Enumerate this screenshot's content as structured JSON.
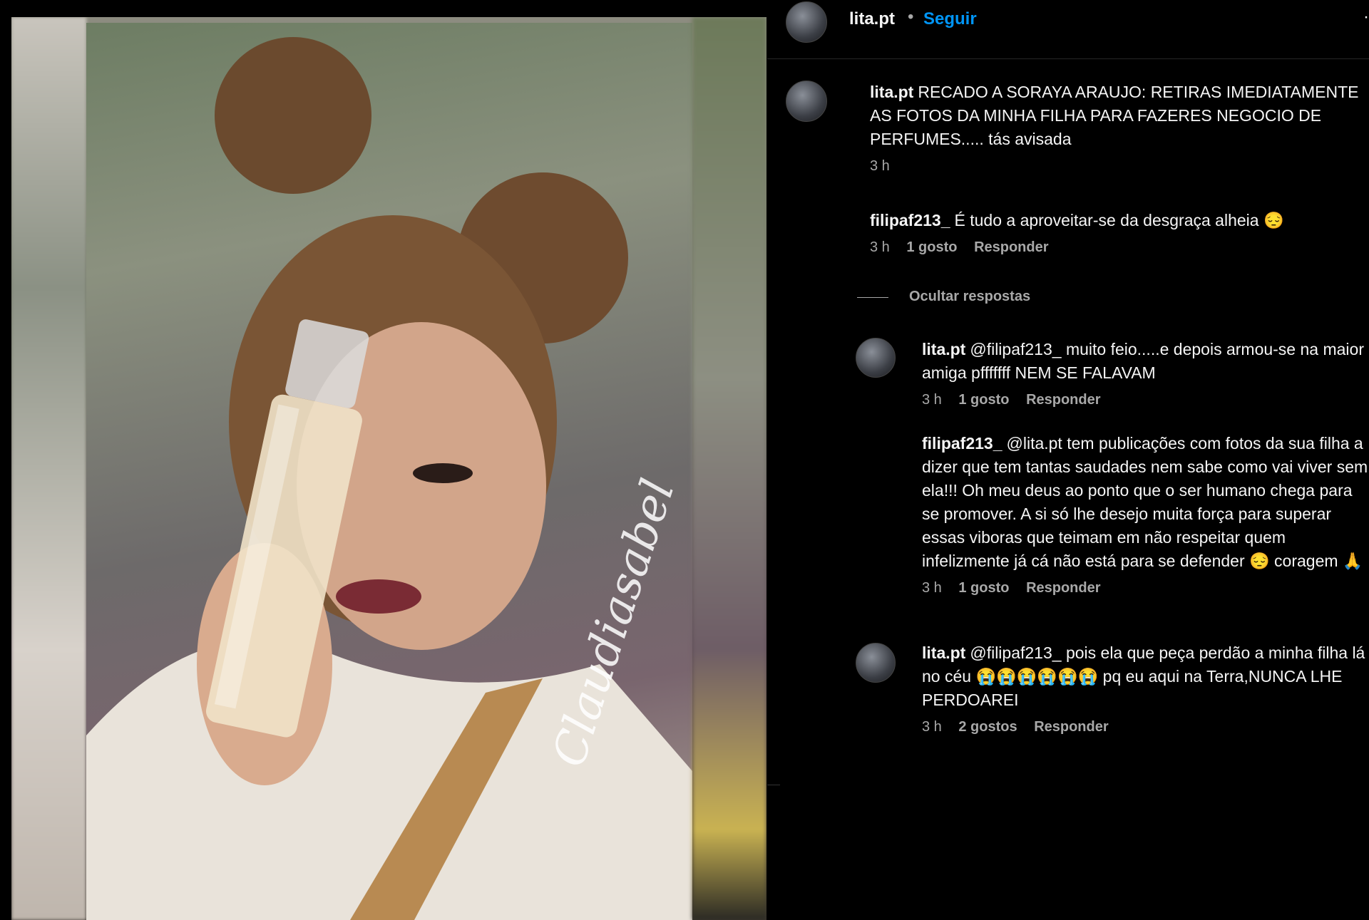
{
  "header": {
    "username": "lita.pt",
    "separator": "•",
    "follow_label": "Seguir",
    "more_label": "·"
  },
  "photo": {
    "watermark": "Claudiasabel"
  },
  "comments": [
    {
      "user": "lita.pt",
      "text": "RECADO A SORAYA ARAUJO: RETIRAS IMEDIATAMENTE AS FOTOS DA MINHA FILHA PARA FAZERES NEGOCIO DE PERFUMES..... tás avisada",
      "time": "3 h"
    },
    {
      "user": "filipaf213_",
      "text": "É tudo a aproveitar-se da desgraça alheia 😔",
      "time": "3 h",
      "likes": "1 gosto",
      "reply_label": "Responder"
    }
  ],
  "hide_replies_label": "Ocultar respostas",
  "replies": [
    {
      "user": "lita.pt",
      "text": "@filipaf213_ muito feio.....e depois armou-se na maior amiga pfffffff NEM SE FALAVAM",
      "time": "3 h",
      "likes": "1 gosto",
      "reply_label": "Responder"
    },
    {
      "user": "filipaf213_",
      "text": "@lita.pt tem publicações com fotos da sua filha a dizer que tem tantas saudades nem sabe como vai viver sem ela!!! Oh meu deus ao ponto que o ser humano chega para se promover. A si só lhe desejo muita força para superar essas viboras que teimam em não respeitar quem infelizmente já cá não está para se defender 😔 coragem 🙏",
      "time": "3 h",
      "likes": "1 gosto",
      "reply_label": "Responder"
    },
    {
      "user": "lita.pt",
      "text": "@filipaf213_ pois ela que peça perdão a minha filha lá no céu 😭😭😭😭😭😭 pq eu aqui na Terra,NUNCA LHE PERDOAREI",
      "time": "3 h",
      "likes": "2 gostos",
      "reply_label": "Responder"
    }
  ]
}
